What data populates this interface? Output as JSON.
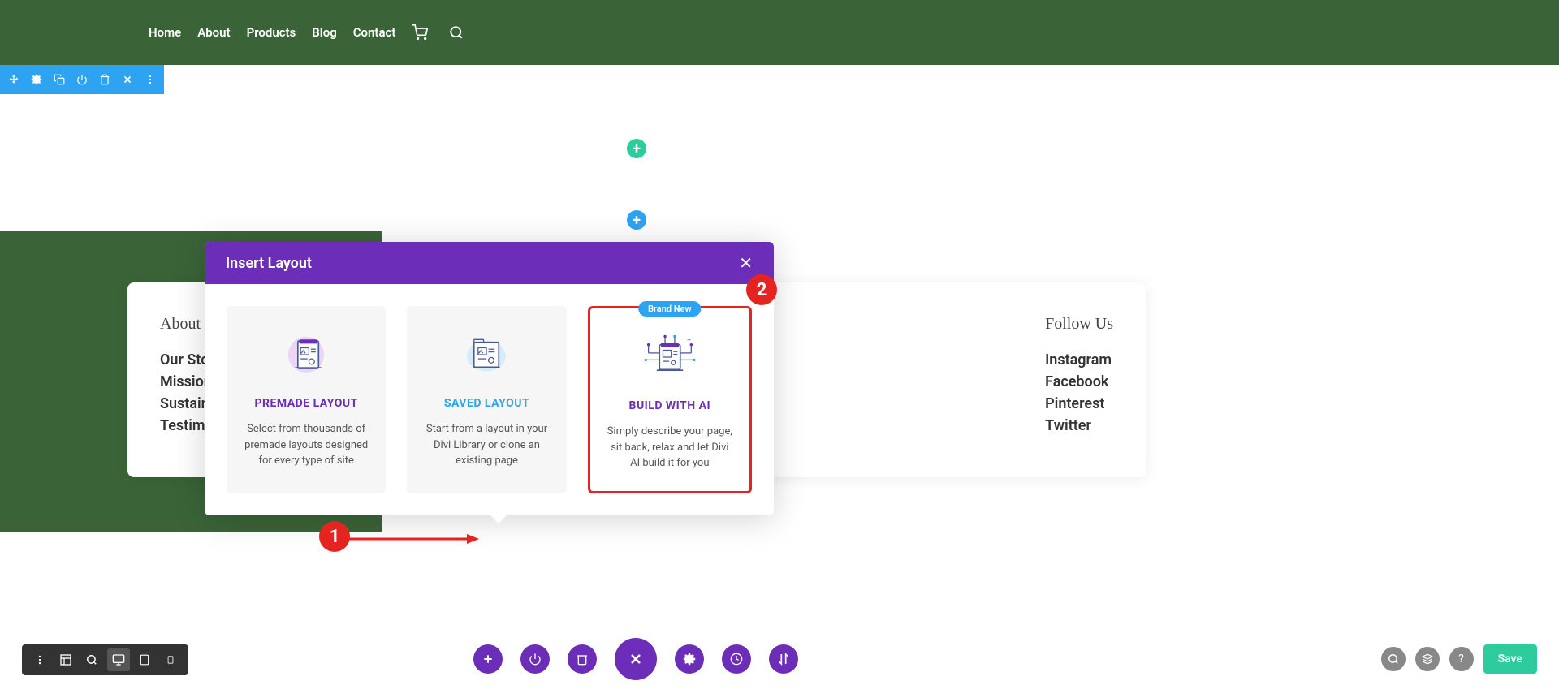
{
  "nav": {
    "items": [
      "Home",
      "About",
      "Products",
      "Blog",
      "Contact"
    ]
  },
  "modal": {
    "title": "Insert Layout",
    "cards": [
      {
        "title": "PREMADE LAYOUT",
        "desc": "Select from thousands of premade layouts designed for every type of site"
      },
      {
        "title": "SAVED LAYOUT",
        "desc": "Start from a layout in your Divi Library or clone an existing page"
      },
      {
        "title": "BUILD WITH AI",
        "desc": "Simply describe your page, sit back, relax and let Divi AI build it for you",
        "badge": "Brand New"
      }
    ]
  },
  "footer": {
    "about_heading": "About H",
    "about_items": [
      "Our Stor",
      "Mission",
      "Sustaina",
      "Testimo"
    ],
    "follow_heading": "Follow Us",
    "follow_items": [
      "Instagram",
      "Facebook",
      "Pinterest",
      "Twitter"
    ]
  },
  "save_label": "Save",
  "annotations": {
    "step1": "1",
    "step2": "2"
  }
}
